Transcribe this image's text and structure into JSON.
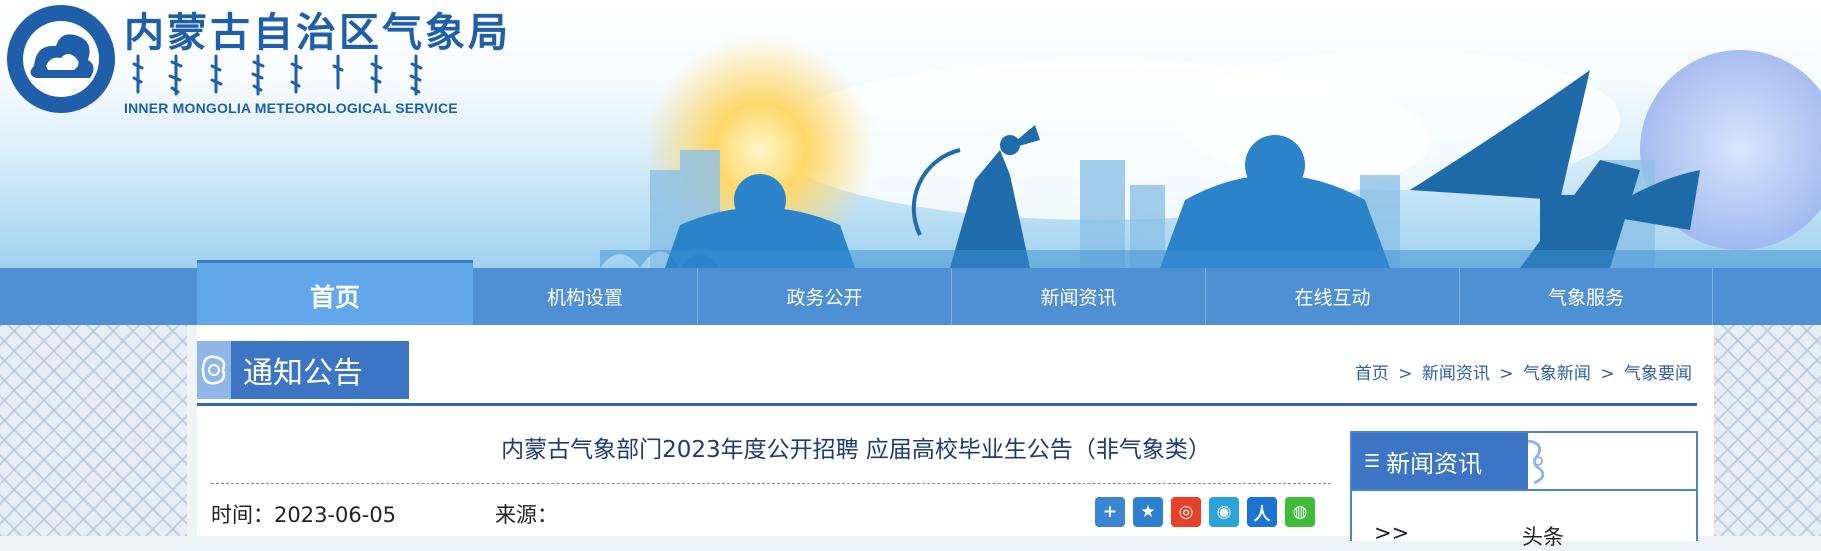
{
  "header": {
    "title_cn": "内蒙古自治区气象局",
    "title_en": "INNER MONGOLIA METEOROLOGICAL SERVICE"
  },
  "nav": {
    "items": [
      "首页",
      "机构设置",
      "政务公开",
      "新闻资讯",
      "在线互动",
      "气象服务"
    ],
    "active": "首页"
  },
  "section_tag": "通知公告",
  "breadcrumb": [
    "首页",
    "新闻资讯",
    "气象新闻",
    "气象要闻"
  ],
  "breadcrumb_sep": ">",
  "article": {
    "title": "内蒙古气象部门2023年度公开招聘 应届高校毕业生公告（非气象类）",
    "time_label": "时间：2023-06-05",
    "source_label": "来源："
  },
  "share_icons": [
    "add-icon",
    "star-icon",
    "weibo-icon",
    "tencent-icon",
    "renren-icon",
    "wechat-icon"
  ],
  "side_panel": {
    "heading": "新闻资讯",
    "menu_glyph": "☰",
    "row_prefix": ">>",
    "row_label": "头条"
  },
  "colors": {
    "brand_blue": "#1f5ea8",
    "nav_blue": "#4f8fd3",
    "active_blue": "#62a7ea",
    "tag_blue": "#3b75c4"
  }
}
